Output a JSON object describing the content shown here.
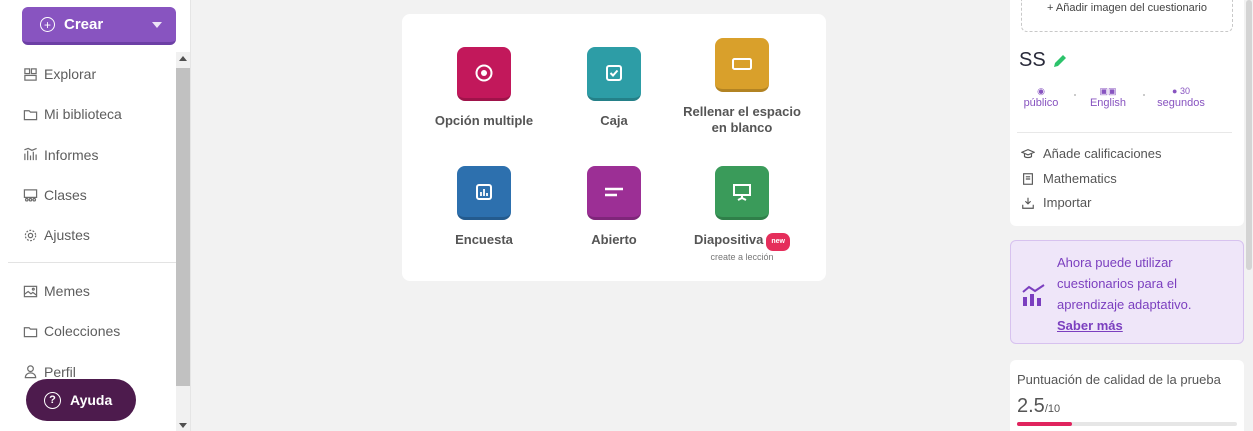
{
  "sidebar": {
    "create_label": "Crear",
    "items": [
      {
        "label": "Explorar",
        "icon": "explore-icon"
      },
      {
        "label": "Mi biblioteca",
        "icon": "folder-icon"
      },
      {
        "label": "Informes",
        "icon": "reports-icon"
      },
      {
        "label": "Clases",
        "icon": "classes-icon"
      },
      {
        "label": "Ajustes",
        "icon": "gear-icon"
      }
    ],
    "items2": [
      {
        "label": "Memes",
        "icon": "memes-icon"
      },
      {
        "label": "Colecciones",
        "icon": "collections-icon"
      },
      {
        "label": "Perfil",
        "icon": "profile-icon"
      }
    ],
    "help_label": "Ayuda"
  },
  "question_types": [
    {
      "label": "Opción multiple",
      "color": "#c2185b",
      "icon": "radio-icon"
    },
    {
      "label": "Caja",
      "color": "#2d9da6",
      "icon": "checkbox-icon"
    },
    {
      "label": "Rellenar el espacio en blanco",
      "color": "#d9a02b",
      "icon": "blank-icon"
    },
    {
      "label": "Encuesta",
      "color": "#2d70ae",
      "icon": "poll-icon"
    },
    {
      "label": "Abierto",
      "color": "#9c2f95",
      "icon": "open-icon"
    },
    {
      "label": "Diapositiva",
      "color": "#3a9b5a",
      "icon": "slide-icon",
      "badge": "new",
      "sub": "create a lección"
    }
  ],
  "right_panel": {
    "add_image": "+ Añadir imagen del cuestionario",
    "quiz_name": "SS",
    "meta": [
      {
        "icon": "eye-icon",
        "value": "público"
      },
      {
        "icon": "language-icon",
        "value": "English"
      },
      {
        "icon": "clock-icon",
        "value": "30 segundos"
      }
    ],
    "meta_time_number": "30",
    "meta_time_unit": "segundos",
    "add_grades": "Añade calificaciones",
    "subject": "Mathematics",
    "import": "Importar",
    "adaptive_text": "Ahora puede utilizar cuestionarios para el aprendizaje adaptativo.",
    "adaptive_link": "Saber más",
    "quality_title": "Puntuación de calidad de la prueba",
    "quality_score": "2.5",
    "quality_max": "/10",
    "quality_fraction": 0.25,
    "accent": "#8854c0"
  }
}
